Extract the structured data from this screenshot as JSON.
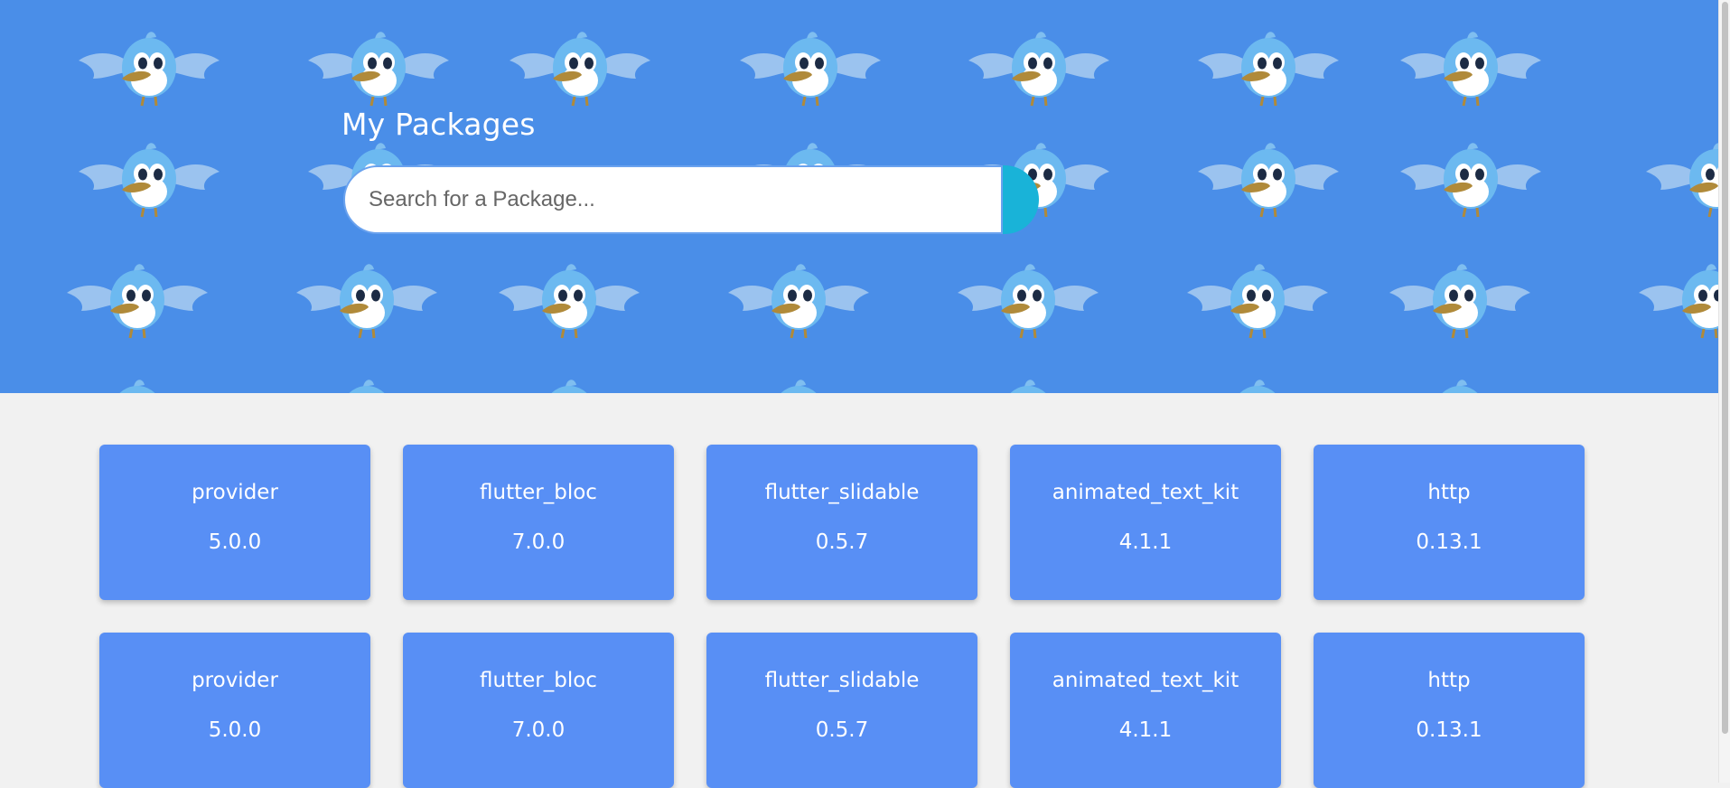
{
  "header": {
    "title": "My Packages",
    "background_color": "#4a8ee8",
    "pattern_icon": "bird-icon"
  },
  "search": {
    "placeholder": "Search for a Package...",
    "value": "",
    "button_icon": "search-button",
    "button_color": "#19b3d8"
  },
  "packages": {
    "card_color": "#588ff5",
    "rows": [
      [
        {
          "name": "provider",
          "version": "5.0.0"
        },
        {
          "name": "flutter_bloc",
          "version": "7.0.0"
        },
        {
          "name": "flutter_slidable",
          "version": "0.5.7"
        },
        {
          "name": "animated_text_kit",
          "version": "4.1.1"
        },
        {
          "name": "http",
          "version": "0.13.1"
        }
      ],
      [
        {
          "name": "provider",
          "version": "5.0.0"
        },
        {
          "name": "flutter_bloc",
          "version": "7.0.0"
        },
        {
          "name": "flutter_slidable",
          "version": "0.5.7"
        },
        {
          "name": "animated_text_kit",
          "version": "4.1.1"
        },
        {
          "name": "http",
          "version": "0.13.1"
        }
      ]
    ]
  }
}
